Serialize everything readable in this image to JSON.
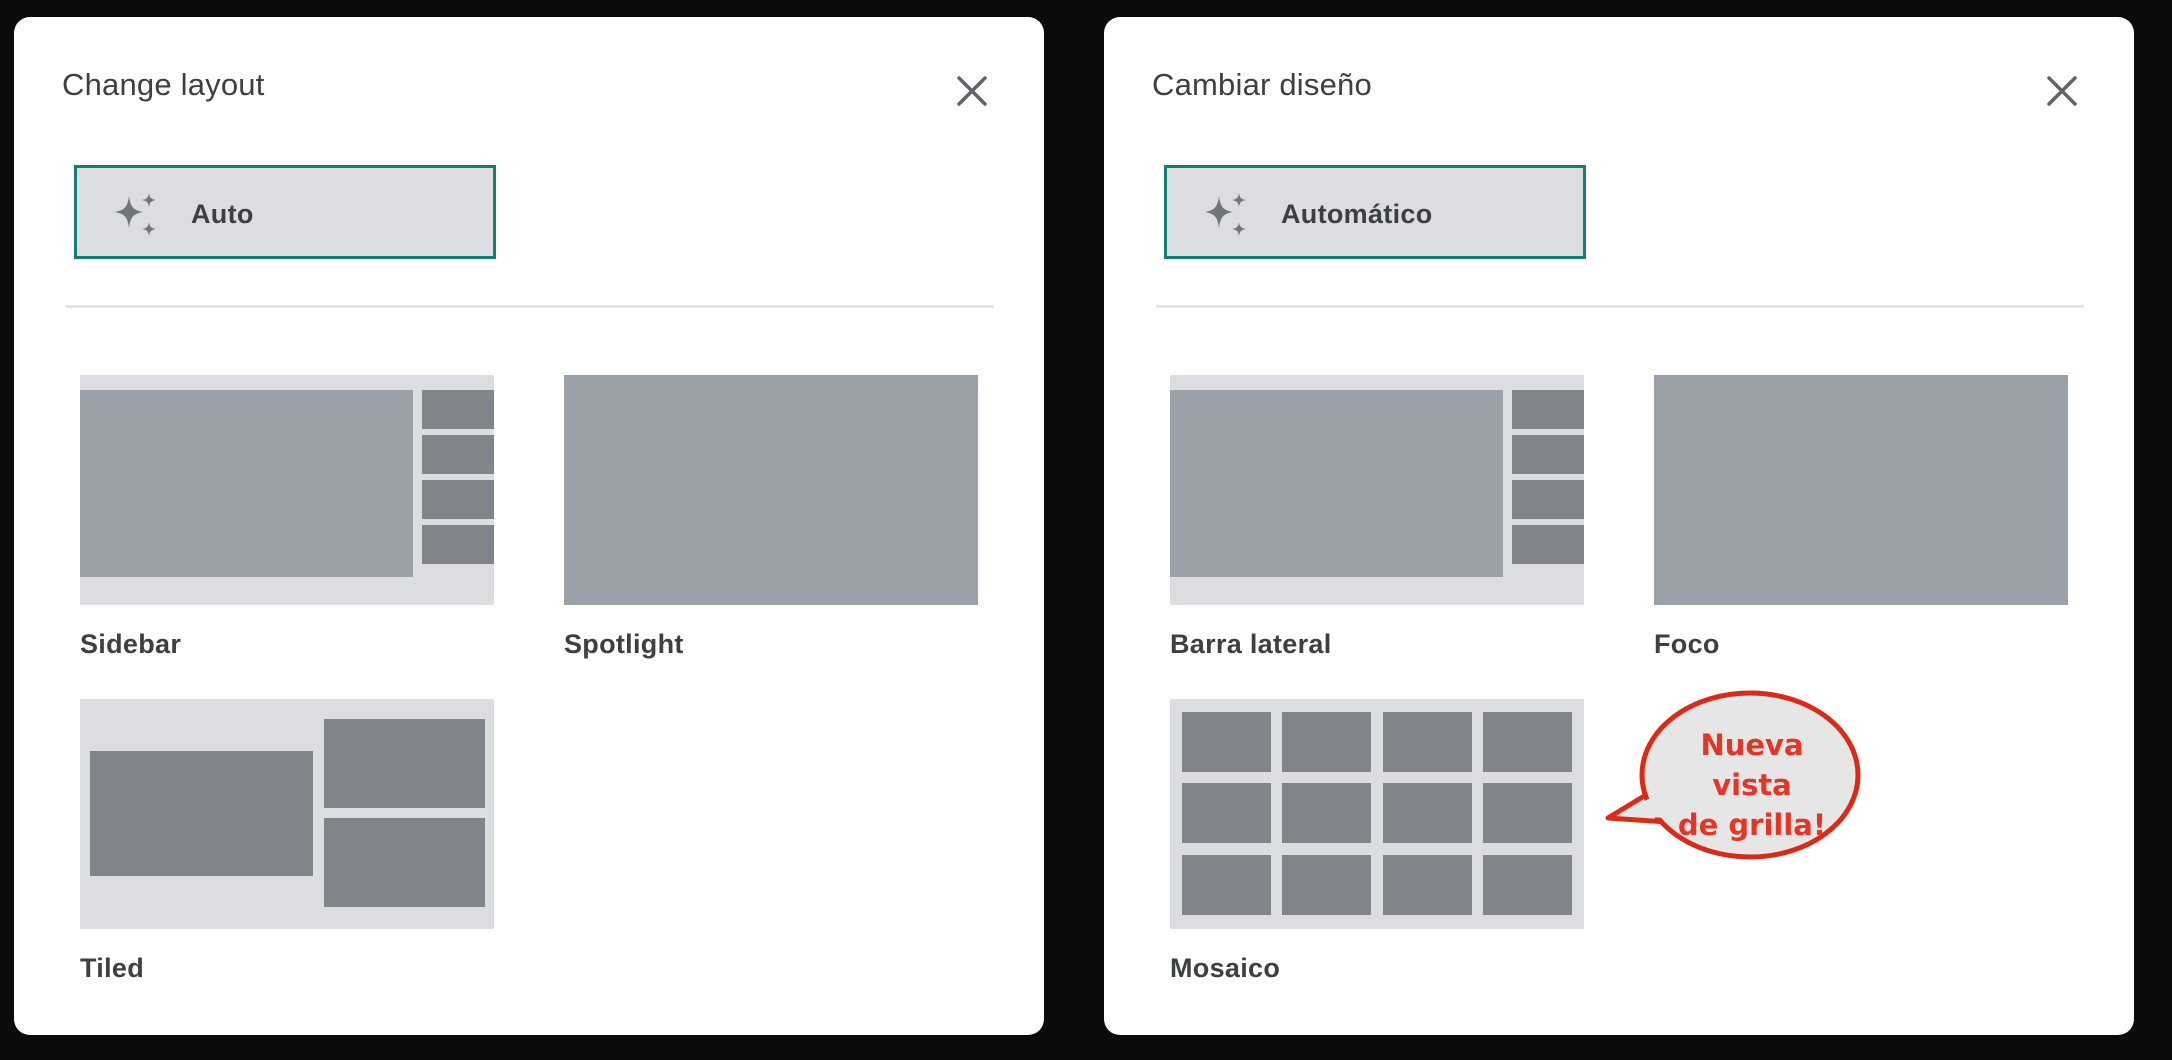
{
  "panels": {
    "en": {
      "title": "Change layout",
      "auto_label": "Auto",
      "options": {
        "sidebar": "Sidebar",
        "spotlight": "Spotlight",
        "tiled": "Tiled"
      }
    },
    "es": {
      "title": "Cambiar diseño",
      "auto_label": "Automático",
      "options": {
        "sidebar": "Barra lateral",
        "spotlight": "Foco",
        "tiled": "Mosaico"
      },
      "callout_line1": "Nueva vista",
      "callout_line2": "de grilla!"
    }
  },
  "icons": {
    "close": "close-icon",
    "auto": "sparkle-icon"
  },
  "colors": {
    "accent_border": "#117f73",
    "callout_red": "#e53527"
  }
}
